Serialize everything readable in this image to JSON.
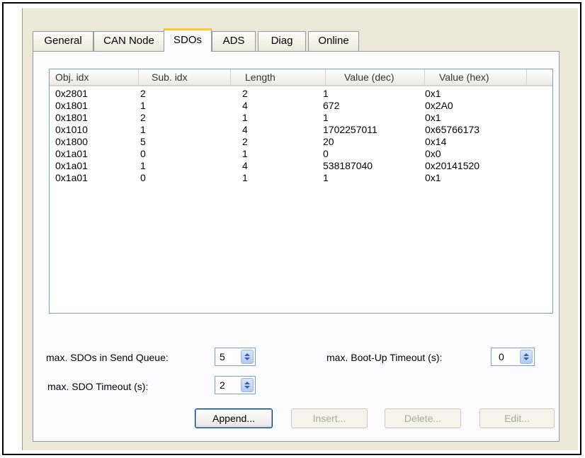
{
  "tabs": [
    {
      "label": "General",
      "active": false
    },
    {
      "label": "CAN Node",
      "active": false
    },
    {
      "label": "SDOs",
      "active": true
    },
    {
      "label": "ADS",
      "active": false
    },
    {
      "label": "Diag",
      "active": false
    },
    {
      "label": "Online",
      "active": false
    }
  ],
  "table": {
    "columns": [
      "Obj. idx",
      "Sub. idx",
      "Length",
      "Value (dec)",
      "Value (hex)"
    ],
    "rows": [
      [
        "0x2801",
        "2",
        "2",
        "1",
        "0x1"
      ],
      [
        "0x1801",
        "1",
        "4",
        "672",
        "0x2A0"
      ],
      [
        "0x1801",
        "2",
        "1",
        "1",
        "0x1"
      ],
      [
        "0x1010",
        "1",
        "4",
        "1702257011",
        "0x65766173"
      ],
      [
        "0x1800",
        "5",
        "2",
        "20",
        "0x14"
      ],
      [
        "0x1a01",
        "0",
        "1",
        "0",
        "0x0"
      ],
      [
        "0x1a01",
        "1",
        "4",
        "538187040",
        "0x20141520"
      ],
      [
        "0x1a01",
        "0",
        "1",
        "1",
        "0x1"
      ]
    ]
  },
  "settings": {
    "send_queue_label": "max. SDOs in Send Queue:",
    "send_queue_value": "5",
    "sdo_timeout_label": "max. SDO Timeout (s):",
    "sdo_timeout_value": "2",
    "bootup_timeout_label": "max. Boot-Up Timeout (s):",
    "bootup_timeout_value": "0"
  },
  "buttons": {
    "append": "Append...",
    "insert": "Insert...",
    "delete": "Delete...",
    "edit": "Edit..."
  }
}
